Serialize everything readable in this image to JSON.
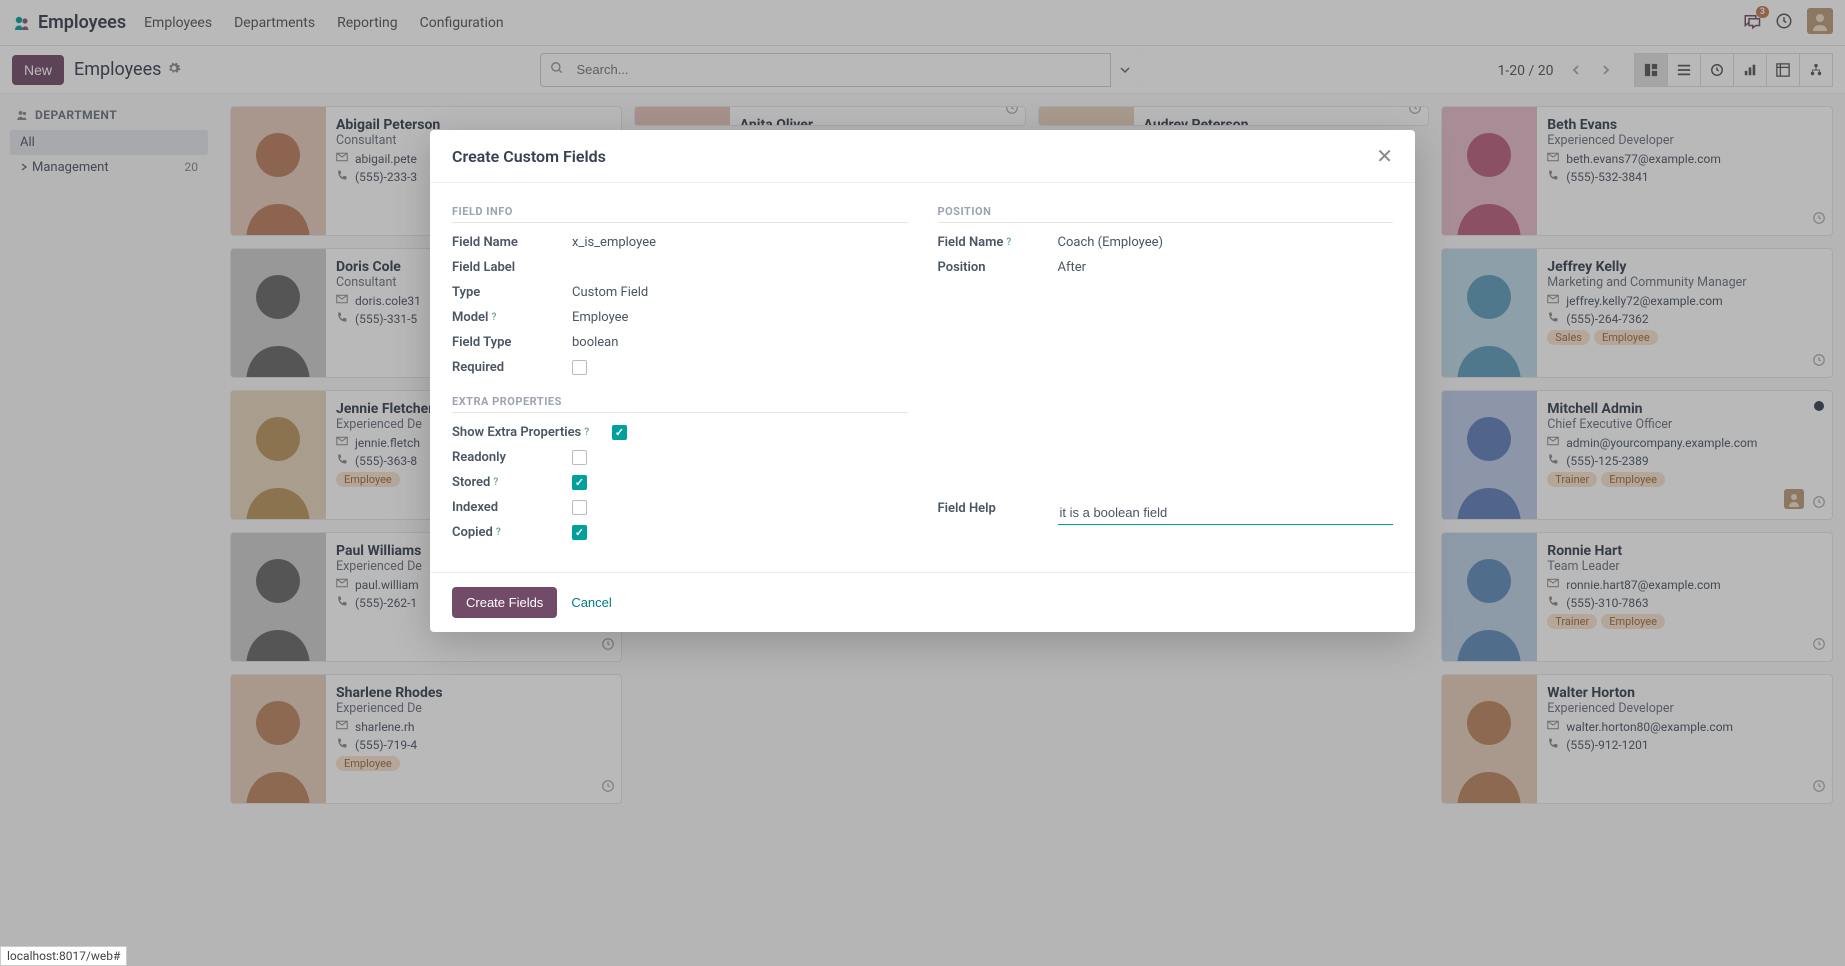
{
  "nav": {
    "app_name": "Employees",
    "links": [
      "Employees",
      "Departments",
      "Reporting",
      "Configuration"
    ],
    "notif_count": "3"
  },
  "toolbar": {
    "new_btn": "New",
    "breadcrumb": "Employees",
    "search_placeholder": "Search...",
    "pager": "1-20 / 20"
  },
  "sidebar": {
    "title": "DEPARTMENT",
    "items": [
      {
        "label": "All",
        "count": "",
        "active": true
      },
      {
        "label": "Management",
        "count": "20",
        "active": false,
        "expandable": true
      }
    ]
  },
  "cards": [
    {
      "name": "Abigail Peterson",
      "role": "Consultant",
      "email": "abigail.pete",
      "phone": "(555)-233-3",
      "tags": [],
      "avatar_hue": 20
    },
    {
      "name": "Anita Oliver",
      "role": "",
      "email": "",
      "phone": "",
      "tags": [],
      "avatar_hue": 10,
      "cut": true
    },
    {
      "name": "Audrey Peterson",
      "role": "",
      "email": "",
      "phone": "",
      "tags": [],
      "avatar_hue": 30,
      "cut": true
    },
    {
      "name": "Beth Evans",
      "role": "Experienced Developer",
      "email": "beth.evans77@example.com",
      "phone": "(555)-532-3841",
      "tags": [],
      "avatar_hue": 340
    },
    {
      "name": "Doris Cole",
      "role": "Consultant",
      "email": "doris.cole31",
      "phone": "(555)-331-5",
      "tags": [],
      "avatar_hue": 0,
      "gray": true
    },
    {
      "name": "",
      "role": "",
      "email": "",
      "phone": "",
      "tags": [],
      "hidden": true
    },
    {
      "name": "",
      "role": "",
      "email": "",
      "phone": "",
      "tags": [],
      "hidden": true
    },
    {
      "name": "Jeffrey Kelly",
      "role": "Marketing and Community Manager",
      "email": "jeffrey.kelly72@example.com",
      "phone": "(555)-264-7362",
      "tags": [
        "Sales",
        "Employee"
      ],
      "avatar_hue": 200
    },
    {
      "name": "Jennie Fletcher",
      "role": "Experienced De",
      "email": "jennie.fletch",
      "phone": "(555)-363-8",
      "tags": [
        "Employee"
      ],
      "avatar_hue": 35
    },
    {
      "name": "",
      "role": "",
      "email": "",
      "phone": "",
      "tags": [],
      "hidden": true
    },
    {
      "name": "",
      "role": "",
      "email": "",
      "phone": "",
      "tags": [],
      "hidden": true
    },
    {
      "name": "Mitchell Admin",
      "role": "Chief Executive Officer",
      "email": "admin@yourcompany.example.com",
      "phone": "(555)-125-2389",
      "tags": [
        "Trainer",
        "Employee"
      ],
      "avatar_hue": 220,
      "status": "active",
      "has_company_avatar": true
    },
    {
      "name": "Paul Williams",
      "role": "Experienced De",
      "email": "paul.william",
      "phone": "(555)-262-1",
      "tags": [],
      "avatar_hue": 45,
      "gray": true
    },
    {
      "name": "",
      "role": "",
      "email": "",
      "phone": "",
      "tags": [],
      "hidden": true
    },
    {
      "name": "",
      "role": "",
      "email": "",
      "phone": "",
      "tags": [],
      "hidden": true
    },
    {
      "name": "Ronnie Hart",
      "role": "Team Leader",
      "email": "ronnie.hart87@example.com",
      "phone": "(555)-310-7863",
      "tags": [
        "Trainer",
        "Employee"
      ],
      "avatar_hue": 210
    },
    {
      "name": "Sharlene Rhodes",
      "role": "Experienced De",
      "email": "sharlene.rh",
      "phone": "(555)-719-4",
      "tags": [
        "Employee"
      ],
      "avatar_hue": 25
    },
    {
      "name": "",
      "role": "",
      "email": "",
      "phone": "",
      "tags": [],
      "hidden": true
    },
    {
      "name": "",
      "role": "",
      "email": "",
      "phone": "",
      "tags": [],
      "hidden": true
    },
    {
      "name": "Walter Horton",
      "role": "Experienced Developer",
      "email": "walter.horton80@example.com",
      "phone": "(555)-912-1201",
      "tags": [],
      "avatar_hue": 25
    }
  ],
  "modal": {
    "title": "Create Custom Fields",
    "section_info": "FIELD INFO",
    "section_pos": "POSITION",
    "section_extra": "EXTRA PROPERTIES",
    "field_name_lbl": "Field Name",
    "field_name_val": "x_is_employee",
    "field_label_lbl": "Field Label",
    "type_lbl": "Type",
    "type_val": "Custom Field",
    "model_lbl": "Model",
    "model_val": "Employee",
    "field_type_lbl": "Field Type",
    "field_type_val": "boolean",
    "required_lbl": "Required",
    "pos_field_name_lbl": "Field Name",
    "pos_field_name_val": "Coach (Employee)",
    "position_lbl": "Position",
    "position_val": "After",
    "show_extra_lbl": "Show Extra Properties",
    "field_help_lbl": "Field Help",
    "field_help_val": "it is a boolean field",
    "readonly_lbl": "Readonly",
    "stored_lbl": "Stored",
    "indexed_lbl": "Indexed",
    "copied_lbl": "Copied",
    "create_btn": "Create Fields",
    "cancel_btn": "Cancel"
  },
  "statusbar": "localhost:8017/web#"
}
